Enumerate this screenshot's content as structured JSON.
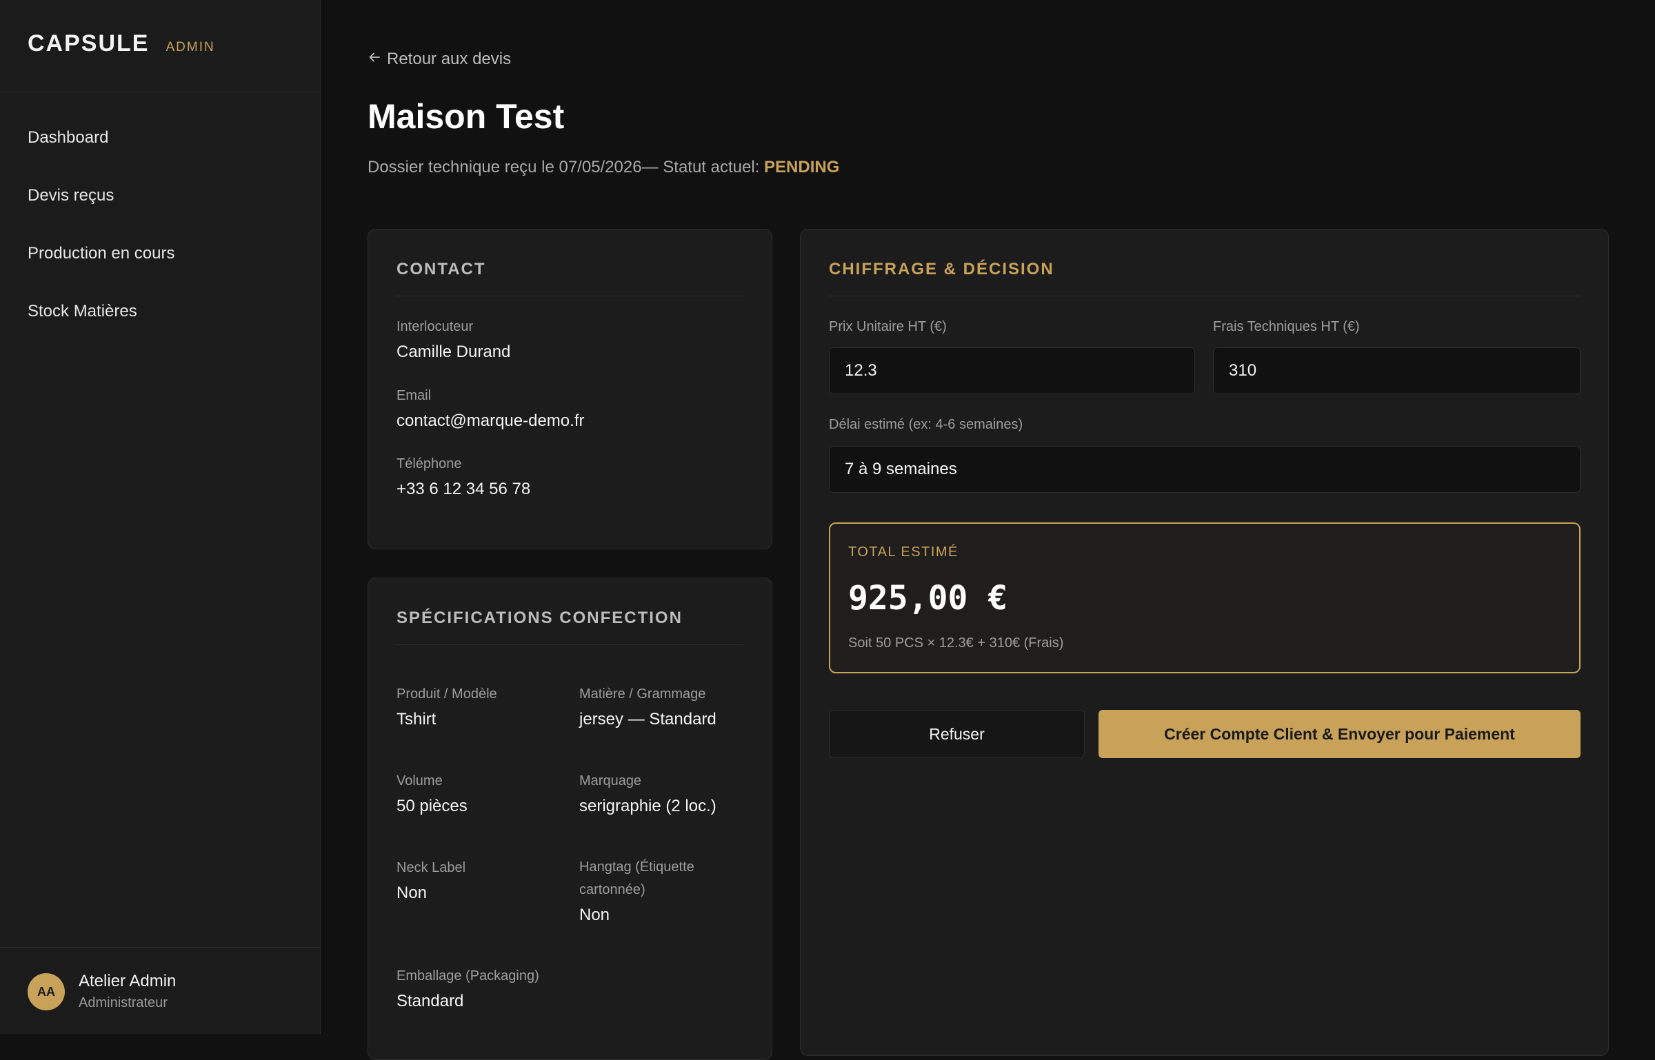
{
  "app": {
    "brand": "CAPSULE",
    "brand_tag": "ADMIN"
  },
  "colors": {
    "accent": "#c9a25a",
    "background": "#111111",
    "card": "#1c1c1c"
  },
  "sidebar": {
    "items": [
      {
        "label": "Dashboard"
      },
      {
        "label": "Devis reçus"
      },
      {
        "label": "Production en cours"
      },
      {
        "label": "Stock Matières"
      }
    ],
    "user": {
      "initials": "AA",
      "name": "Atelier Admin",
      "role": "Administrateur"
    }
  },
  "header": {
    "back_label": "Retour aux devis",
    "back_icon": "arrow-left-icon",
    "title": "Maison Test",
    "subtitle_prefix": "Dossier technique reçu le 07/05/2026— Statut actuel: ",
    "status": "PENDING"
  },
  "contact": {
    "title": "CONTACT",
    "fields": [
      {
        "label": "Interlocuteur",
        "value": "Camille Durand"
      },
      {
        "label": "Email",
        "value": "contact@marque-demo.fr"
      },
      {
        "label": "Téléphone",
        "value": "+33 6 12 34 56 78"
      }
    ]
  },
  "specs": {
    "title": "SPÉCIFICATIONS CONFECTION",
    "fields": [
      {
        "label": "Produit / Modèle",
        "value": "Tshirt"
      },
      {
        "label": "Matière / Grammage",
        "value": "jersey — Standard"
      },
      {
        "label": "Volume",
        "value": "50 pièces"
      },
      {
        "label": "Marquage",
        "value": "serigraphie (2 loc.)"
      },
      {
        "label": "Neck Label",
        "value": "Non"
      },
      {
        "label": "Hangtag (Étiquette cartonnée)",
        "value": "Non"
      },
      {
        "label": "Emballage (Packaging)",
        "value": "Standard"
      }
    ]
  },
  "decision": {
    "title": "CHIFFRAGE & DÉCISION",
    "unit_price_label": "Prix Unitaire HT (€)",
    "unit_price_value": "12.3",
    "tech_fees_label": "Frais Techniques HT (€)",
    "tech_fees_value": "310",
    "delay_label": "Délai estimé (ex: 4-6 semaines)",
    "delay_value": "7 à 9 semaines",
    "total_label": "TOTAL ESTIMÉ",
    "total_value": "925,00 €",
    "total_detail": "Soit 50 PCS × 12.3€ + 310€ (Frais)",
    "refuse_label": "Refuser",
    "create_label": "Créer Compte Client & Envoyer pour Paiement"
  }
}
